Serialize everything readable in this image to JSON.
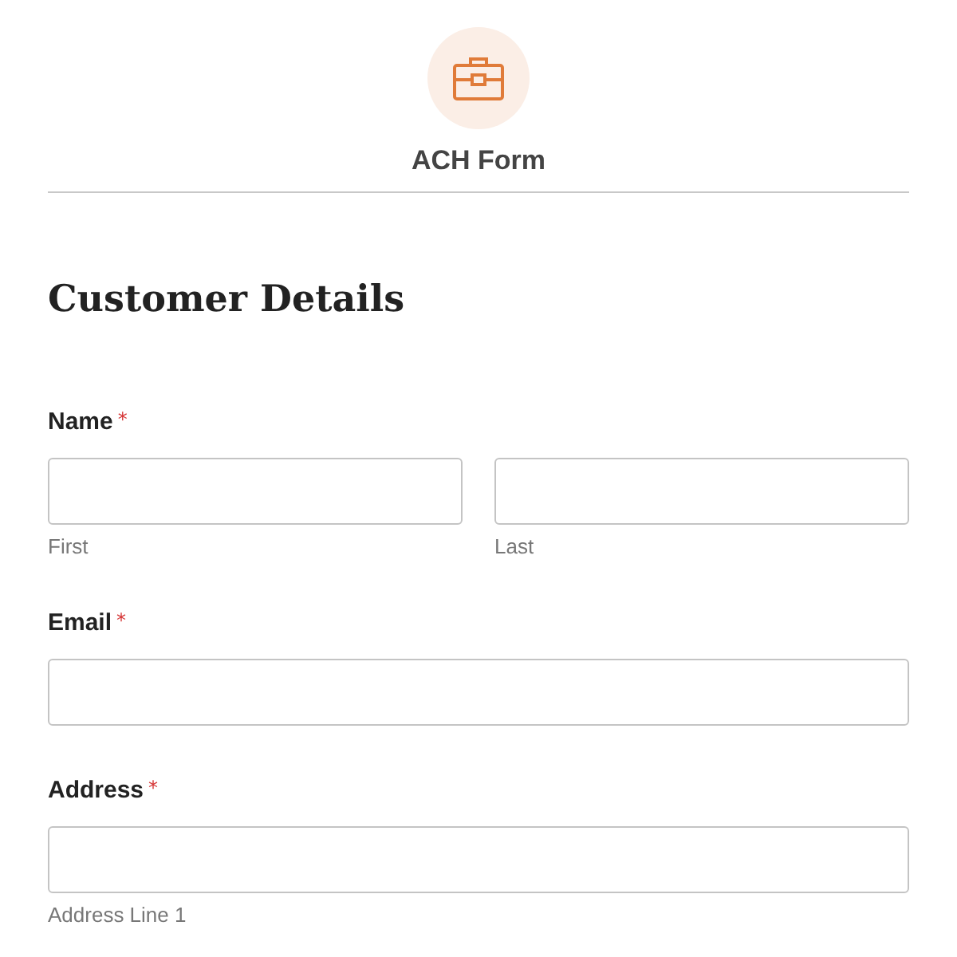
{
  "header": {
    "title": "ACH Form"
  },
  "section_title": "Customer Details",
  "fields": [
    {
      "label": "Name",
      "required_mark": "*",
      "kind": "split",
      "sublabels": [
        "First",
        "Last"
      ]
    },
    {
      "label": "Email",
      "required_mark": "*",
      "kind": "single"
    },
    {
      "label": "Address",
      "required_mark": "*",
      "kind": "labeled",
      "sublabels": [
        "Address Line 1"
      ]
    }
  ]
}
